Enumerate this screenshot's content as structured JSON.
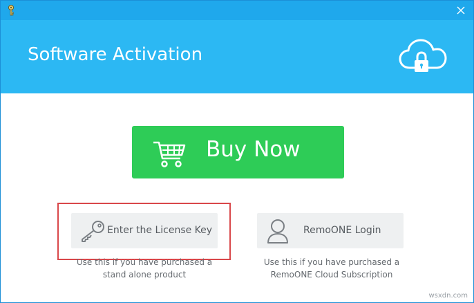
{
  "window": {
    "title_bar_color": "#1fa8ec",
    "close_icon": "close-icon",
    "app_icon": "key-icon"
  },
  "header": {
    "title": "Software Activation",
    "background_color": "#2cb8f3",
    "icon": "cloud-lock-icon"
  },
  "buy_now": {
    "label": "Buy Now",
    "color": "#2ecc57",
    "icon": "shopping-cart-icon"
  },
  "options": {
    "license": {
      "label": "Enter the License Key",
      "icon": "key-icon",
      "description_line1": "Use this if you have purchased a",
      "description_line2": "stand alone product"
    },
    "remo": {
      "label": "RemoONE Login",
      "icon": "user-icon",
      "description_line1": "Use this if you have purchased a",
      "description_line2": "RemoONE Cloud Subscription"
    }
  },
  "highlight_color": "#d9474a",
  "watermark": "wsxdn.com"
}
